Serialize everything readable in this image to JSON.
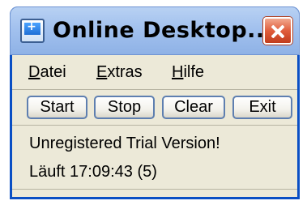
{
  "window": {
    "title": "Online Desktop..."
  },
  "menu": {
    "datei": {
      "first": "D",
      "rest": "atei"
    },
    "extras": {
      "first": "E",
      "rest": "xtras"
    },
    "hilfe": {
      "first": "H",
      "rest": "ilfe"
    }
  },
  "toolbar": {
    "start_label": "Start",
    "stop_label": "Stop",
    "clear_label": "Clear",
    "exit_label": "Exit"
  },
  "status": {
    "registration": "Unregistered Trial Version!",
    "running": "Läuft 17:09:43 (5)"
  },
  "colors": {
    "title_bar": "#a2c1ee",
    "window_border": "#0a4fc4",
    "close_button": "#e05d3c",
    "window_body": "#ece9d8"
  },
  "icons": {
    "app": "app-monitor-icon",
    "close": "close-icon"
  }
}
